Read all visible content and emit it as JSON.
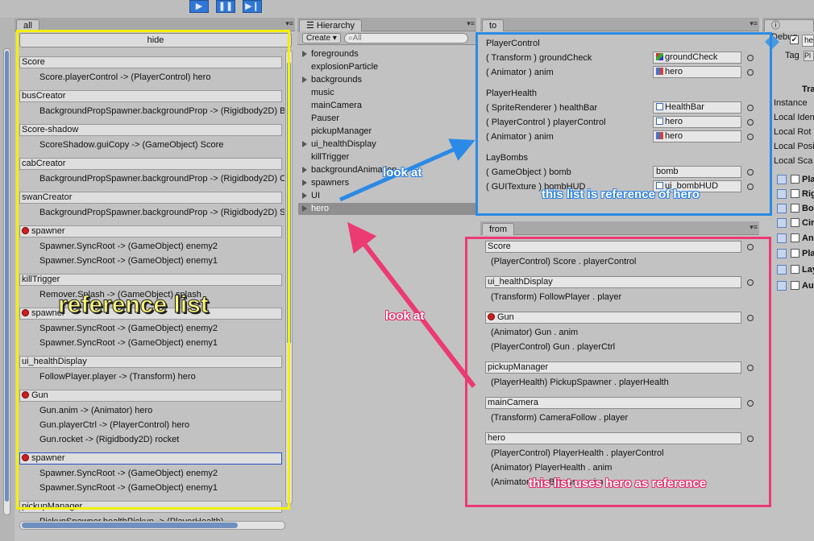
{
  "toolbar": {
    "play": "▶",
    "pause": "❚❚",
    "step": "▶❙"
  },
  "left": {
    "tab": "all",
    "hide_label": "hide",
    "groups": [
      {
        "name": "Score",
        "dot": false,
        "rows": [
          "Score.playerControl -> (PlayerControl) hero"
        ]
      },
      {
        "name": "busCreator",
        "dot": false,
        "rows": [
          "BackgroundPropSpawner.backgroundProp -> (Rigidbody2D) Bus"
        ]
      },
      {
        "name": "Score-shadow",
        "dot": false,
        "rows": [
          "ScoreShadow.guiCopy -> (GameObject) Score"
        ]
      },
      {
        "name": "cabCreator",
        "dot": false,
        "rows": [
          "BackgroundPropSpawner.backgroundProp -> (Rigidbody2D) Cab"
        ]
      },
      {
        "name": "swanCreator",
        "dot": false,
        "rows": [
          "BackgroundPropSpawner.backgroundProp -> (Rigidbody2D) Swan"
        ]
      },
      {
        "name": "spawner",
        "dot": true,
        "rows": [
          "Spawner.SyncRoot -> (GameObject) enemy2",
          "Spawner.SyncRoot -> (GameObject) enemy1"
        ]
      },
      {
        "name": "killTrigger",
        "dot": false,
        "rows": [
          "Remover.Splash -> (GameObject) splash"
        ]
      },
      {
        "name": "spawner",
        "dot": true,
        "rows": [
          "Spawner.SyncRoot -> (GameObject) enemy2",
          "Spawner.SyncRoot -> (GameObject) enemy1"
        ]
      },
      {
        "name": "ui_healthDisplay",
        "dot": false,
        "rows": [
          "FollowPlayer.player -> (Transform) hero"
        ]
      },
      {
        "name": "Gun",
        "dot": true,
        "rows": [
          "Gun.anim -> (Animator) hero",
          "Gun.playerCtrl -> (PlayerControl) hero",
          "Gun.rocket -> (Rigidbody2D) rocket"
        ]
      },
      {
        "name": "spawner",
        "dot": true,
        "selected": true,
        "rows": [
          "Spawner.SyncRoot -> (GameObject) enemy2",
          "Spawner.SyncRoot -> (GameObject) enemy1"
        ]
      },
      {
        "name": "pickupManager",
        "dot": false,
        "rows": [
          "PickupSpawner.healthPickup -> (PlayerHealth)"
        ]
      }
    ]
  },
  "hierarchy": {
    "tab": "Hierarchy",
    "create_label": "Create",
    "search_placeholder": "All",
    "items": [
      {
        "label": "foregrounds",
        "expand": true
      },
      {
        "label": "explosionParticle",
        "expand": false
      },
      {
        "label": "backgrounds",
        "expand": true
      },
      {
        "label": "music",
        "expand": false
      },
      {
        "label": "mainCamera",
        "expand": false
      },
      {
        "label": "Pauser",
        "expand": false
      },
      {
        "label": "pickupManager",
        "expand": false
      },
      {
        "label": "ui_healthDisplay",
        "expand": true
      },
      {
        "label": "killTrigger",
        "expand": false
      },
      {
        "label": "backgroundAnimation",
        "expand": true
      },
      {
        "label": "spawners",
        "expand": true
      },
      {
        "label": "UI",
        "expand": true
      },
      {
        "label": "hero",
        "expand": true,
        "selected": true
      }
    ]
  },
  "to_panel": {
    "tab": "to",
    "sections": [
      {
        "name": "PlayerControl",
        "fields": [
          {
            "label": "( Transform ) groundCheck",
            "value": "groundCheck",
            "icon": "transform-icon"
          },
          {
            "label": "( Animator ) anim",
            "value": "hero",
            "icon": "animator-icon"
          }
        ]
      },
      {
        "name": "PlayerHealth",
        "fields": [
          {
            "label": "( SpriteRenderer ) healthBar",
            "value": "HealthBar",
            "icon": "sprite-icon"
          },
          {
            "label": "( PlayerControl ) playerControl",
            "value": "hero",
            "icon": "script-icon"
          },
          {
            "label": "( Animator ) anim",
            "value": "hero",
            "icon": "animator-icon"
          }
        ]
      },
      {
        "name": "LayBombs",
        "fields": [
          {
            "label": "( GameObject ) bomb",
            "value": "bomb",
            "icon": ""
          },
          {
            "label": "( GUITexture ) bombHUD",
            "value": "ui_bombHUD",
            "icon": "guitexture-icon"
          }
        ]
      }
    ]
  },
  "from_panel": {
    "tab": "from",
    "groups": [
      {
        "name": "Score",
        "dot": false,
        "rows": [
          "(PlayerControl) Score . playerControl"
        ]
      },
      {
        "name": "ui_healthDisplay",
        "dot": false,
        "rows": [
          "(Transform) FollowPlayer . player"
        ]
      },
      {
        "name": "Gun",
        "dot": true,
        "rows": [
          "(Animator) Gun . anim",
          "(PlayerControl) Gun . playerCtrl"
        ]
      },
      {
        "name": "pickupManager",
        "dot": false,
        "rows": [
          "(PlayerHealth) PickupSpawner . playerHealth"
        ]
      },
      {
        "name": "mainCamera",
        "dot": false,
        "rows": [
          "(Transform) CameraFollow . player"
        ]
      },
      {
        "name": "hero",
        "dot": false,
        "rows": [
          "(PlayerControl) PlayerHealth . playerControl",
          "(Animator) PlayerHealth . anim",
          "(Animator) LayBombs . anim"
        ]
      }
    ]
  },
  "debug": {
    "tab": "Debug",
    "name_value": "he",
    "tag_label": "Tag",
    "tag_value": "Pl",
    "rows": [
      "Tra",
      "Instance",
      "Local Iden",
      "Local Rot",
      "Local Posi",
      "Local Sca",
      "Pla",
      "Rig",
      "Bo",
      "Cir",
      "An",
      "Pla",
      "Lay",
      "Au"
    ]
  },
  "annotations": {
    "reference_list": "reference list",
    "look_at_1": "look at",
    "look_at_2": "look at",
    "to_caption": "this list is reference of hero",
    "from_caption": "this list uses hero as reference"
  },
  "colors": {
    "yellow": "#f4f000",
    "blue": "#2b8ae6",
    "pink": "#ec3a73"
  }
}
